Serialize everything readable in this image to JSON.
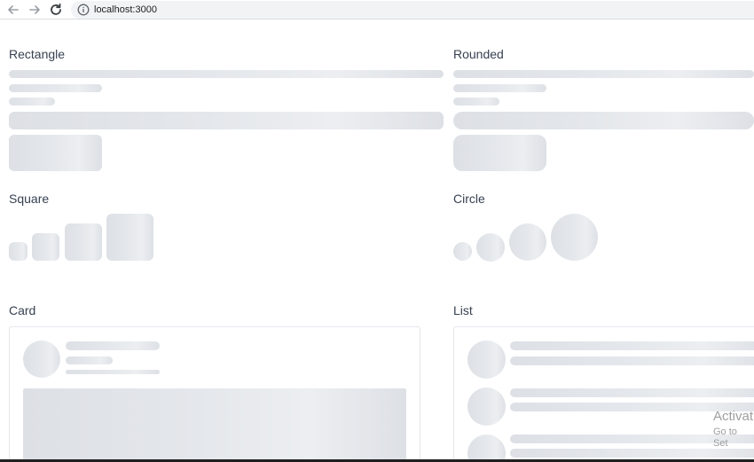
{
  "browser": {
    "url": "localhost:3000",
    "icons": {
      "back": "arrow-left-icon",
      "forward": "arrow-right-icon",
      "reload": "reload-icon",
      "info": "info-icon"
    }
  },
  "sections": {
    "rectangle": "Rectangle",
    "rounded": "Rounded",
    "square": "Square",
    "circle": "Circle",
    "card": "Card",
    "list": "List"
  },
  "watermark": {
    "title": "Activat",
    "subtitle": "Go to Set"
  },
  "colors": {
    "skeleton": "#dde0e5",
    "skeleton_highlight": "#eceef1",
    "heading": "#374151",
    "border": "#e5e7eb"
  }
}
